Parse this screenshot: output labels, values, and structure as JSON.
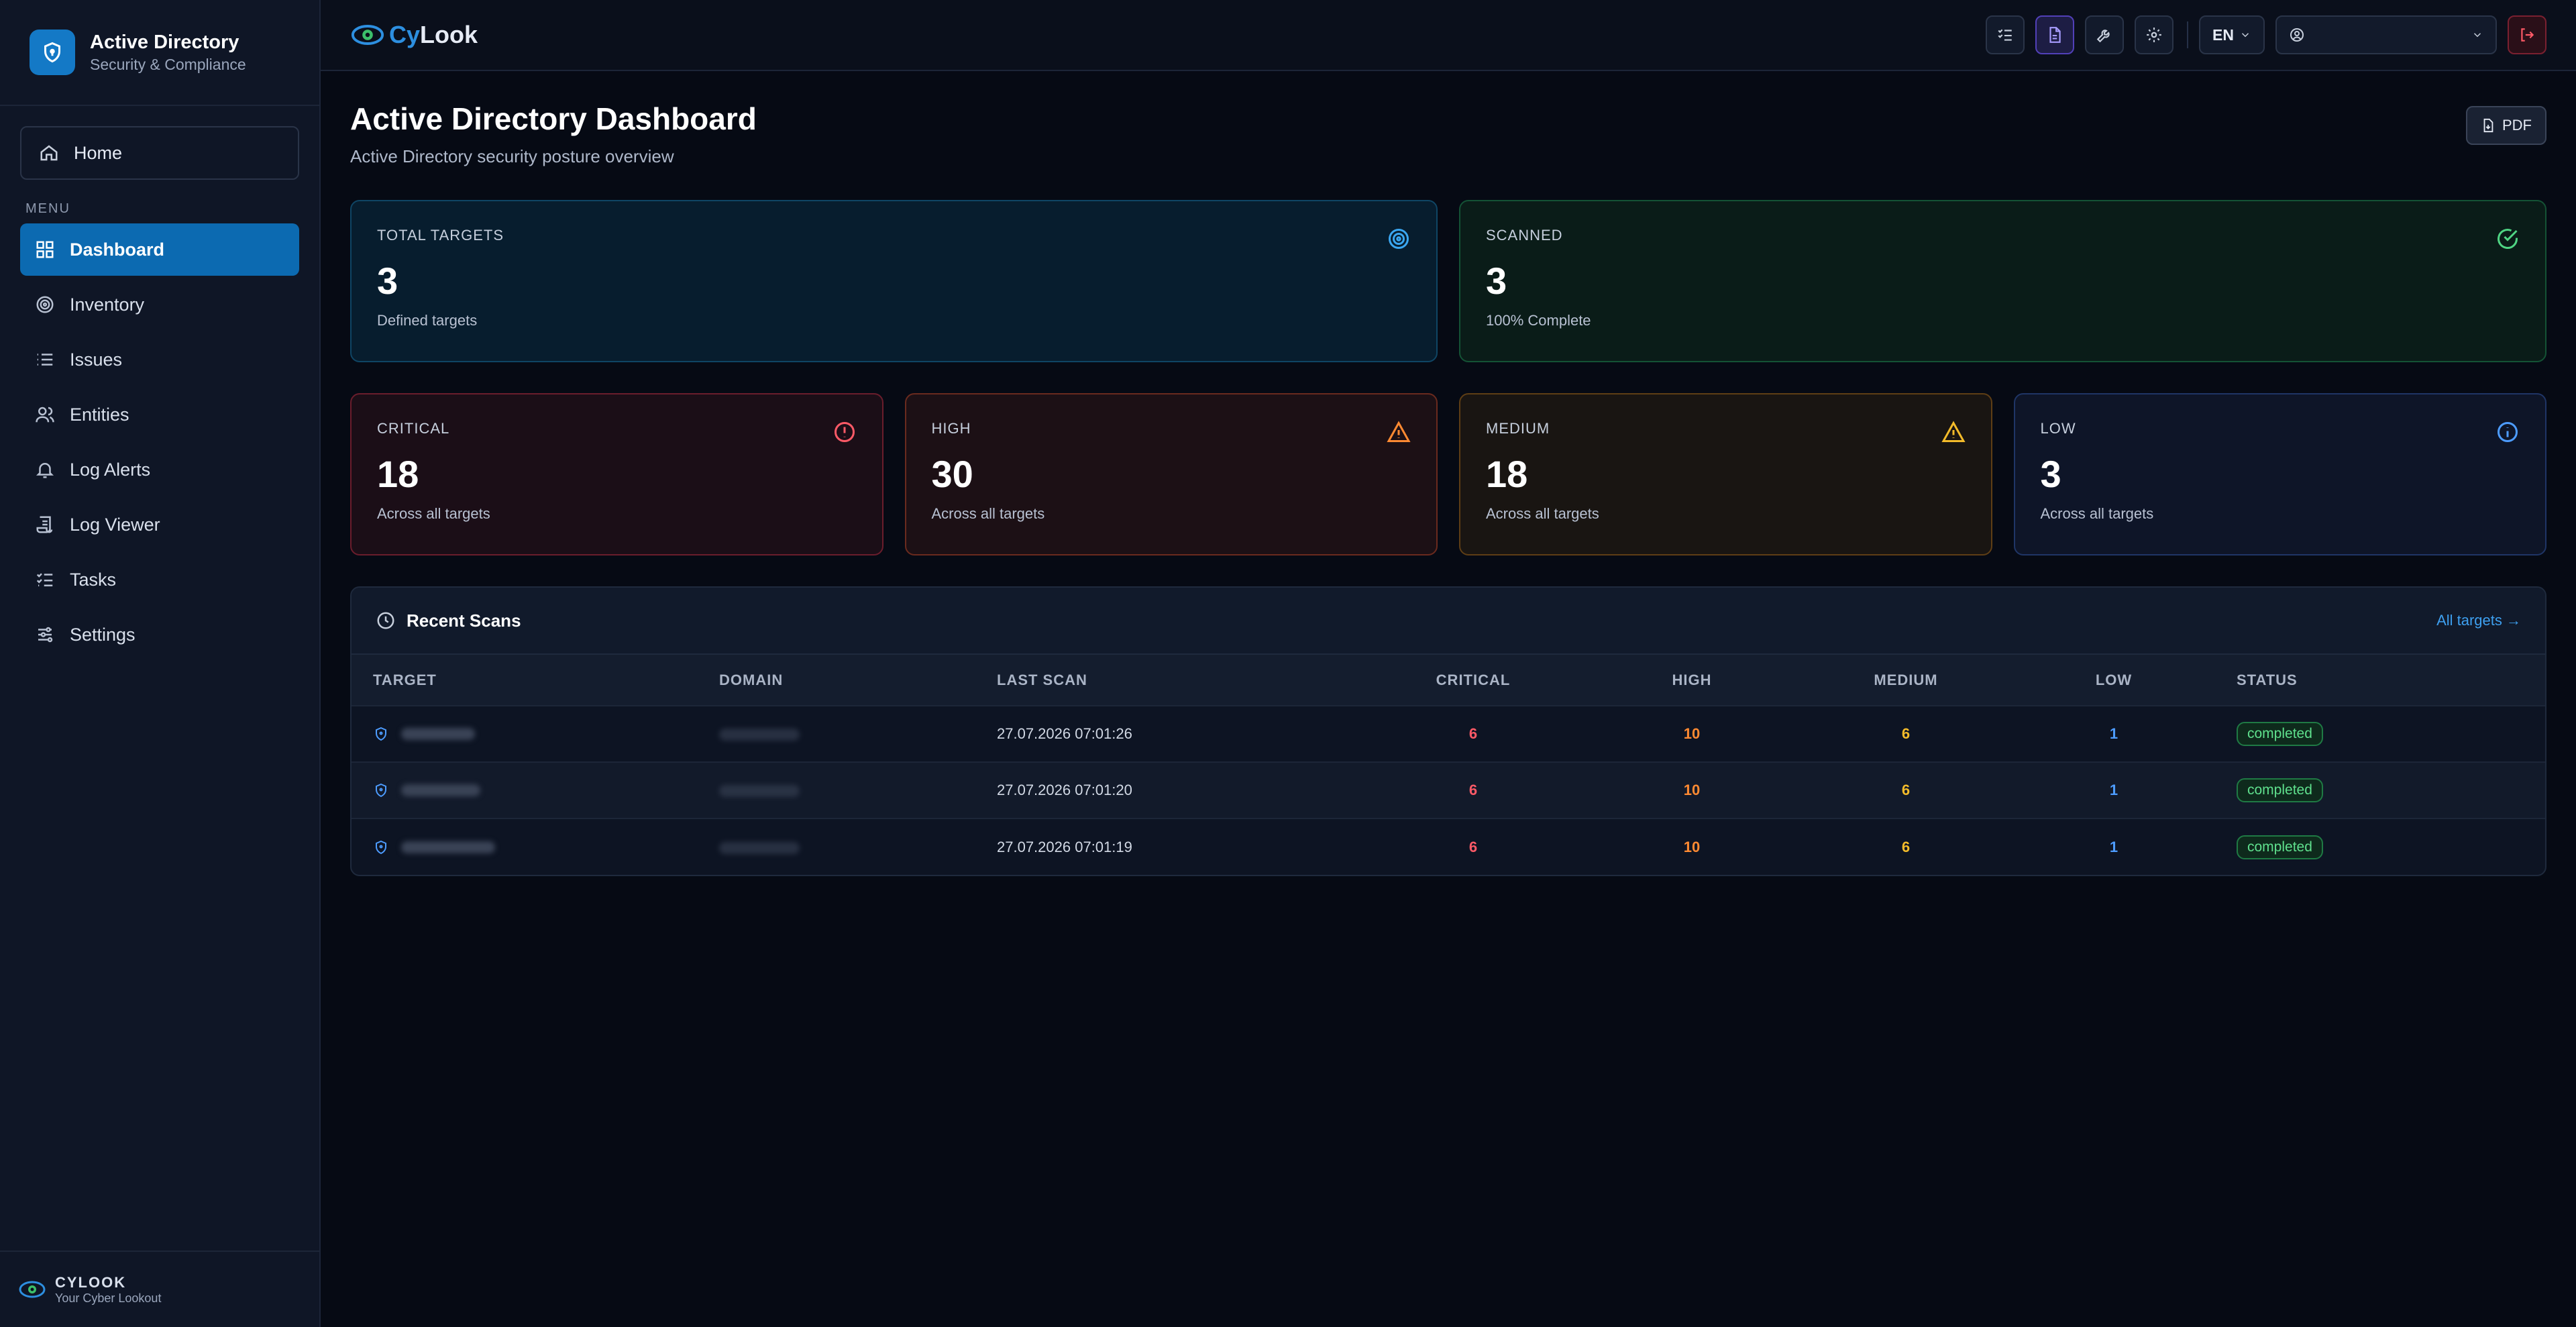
{
  "sidebar": {
    "brand_title": "Active Directory",
    "brand_subtitle": "Security & Compliance",
    "home_label": "Home",
    "menu_title": "MENU",
    "items": [
      {
        "label": "Dashboard",
        "icon": "dashboard-icon",
        "active": true
      },
      {
        "label": "Inventory",
        "icon": "target-icon"
      },
      {
        "label": "Issues",
        "icon": "list-icon"
      },
      {
        "label": "Entities",
        "icon": "users-icon"
      },
      {
        "label": "Log Alerts",
        "icon": "bell-icon"
      },
      {
        "label": "Log Viewer",
        "icon": "scroll-icon"
      },
      {
        "label": "Tasks",
        "icon": "tasks-icon"
      },
      {
        "label": "Settings",
        "icon": "sliders-icon"
      }
    ],
    "footer_title": "CYLOOK",
    "footer_subtitle": "Your Cyber Lookout"
  },
  "topbar": {
    "logo_cy": "Cy",
    "logo_look": "Look",
    "lang": "EN"
  },
  "page": {
    "title": "Active Directory Dashboard",
    "subtitle": "Active Directory security posture overview",
    "pdf_label": "PDF"
  },
  "stats": {
    "total": {
      "label": "TOTAL TARGETS",
      "value": "3",
      "sub": "Defined targets"
    },
    "scanned": {
      "label": "SCANNED",
      "value": "3",
      "sub": "100% Complete"
    },
    "critical": {
      "label": "CRITICAL",
      "value": "18",
      "sub": "Across all targets"
    },
    "high": {
      "label": "HIGH",
      "value": "30",
      "sub": "Across all targets"
    },
    "medium": {
      "label": "MEDIUM",
      "value": "18",
      "sub": "Across all targets"
    },
    "low": {
      "label": "LOW",
      "value": "3",
      "sub": "Across all targets"
    }
  },
  "colors": {
    "accent": "#0c6ab1",
    "critical": "#ff5a67",
    "high": "#ff8a32",
    "medium": "#f3bb2a",
    "low": "#4d9cff",
    "success": "#5fe08d"
  },
  "recent": {
    "title": "Recent Scans",
    "link": "All targets →",
    "columns": [
      "TARGET",
      "DOMAIN",
      "LAST SCAN",
      "CRITICAL",
      "HIGH",
      "MEDIUM",
      "LOW",
      "STATUS"
    ],
    "rows": [
      {
        "last_scan": "27.07.2026 07:01:26",
        "critical": "6",
        "high": "10",
        "medium": "6",
        "low": "1",
        "status": "completed"
      },
      {
        "last_scan": "27.07.2026 07:01:20",
        "critical": "6",
        "high": "10",
        "medium": "6",
        "low": "1",
        "status": "completed"
      },
      {
        "last_scan": "27.07.2026 07:01:19",
        "critical": "6",
        "high": "10",
        "medium": "6",
        "low": "1",
        "status": "completed"
      }
    ]
  }
}
